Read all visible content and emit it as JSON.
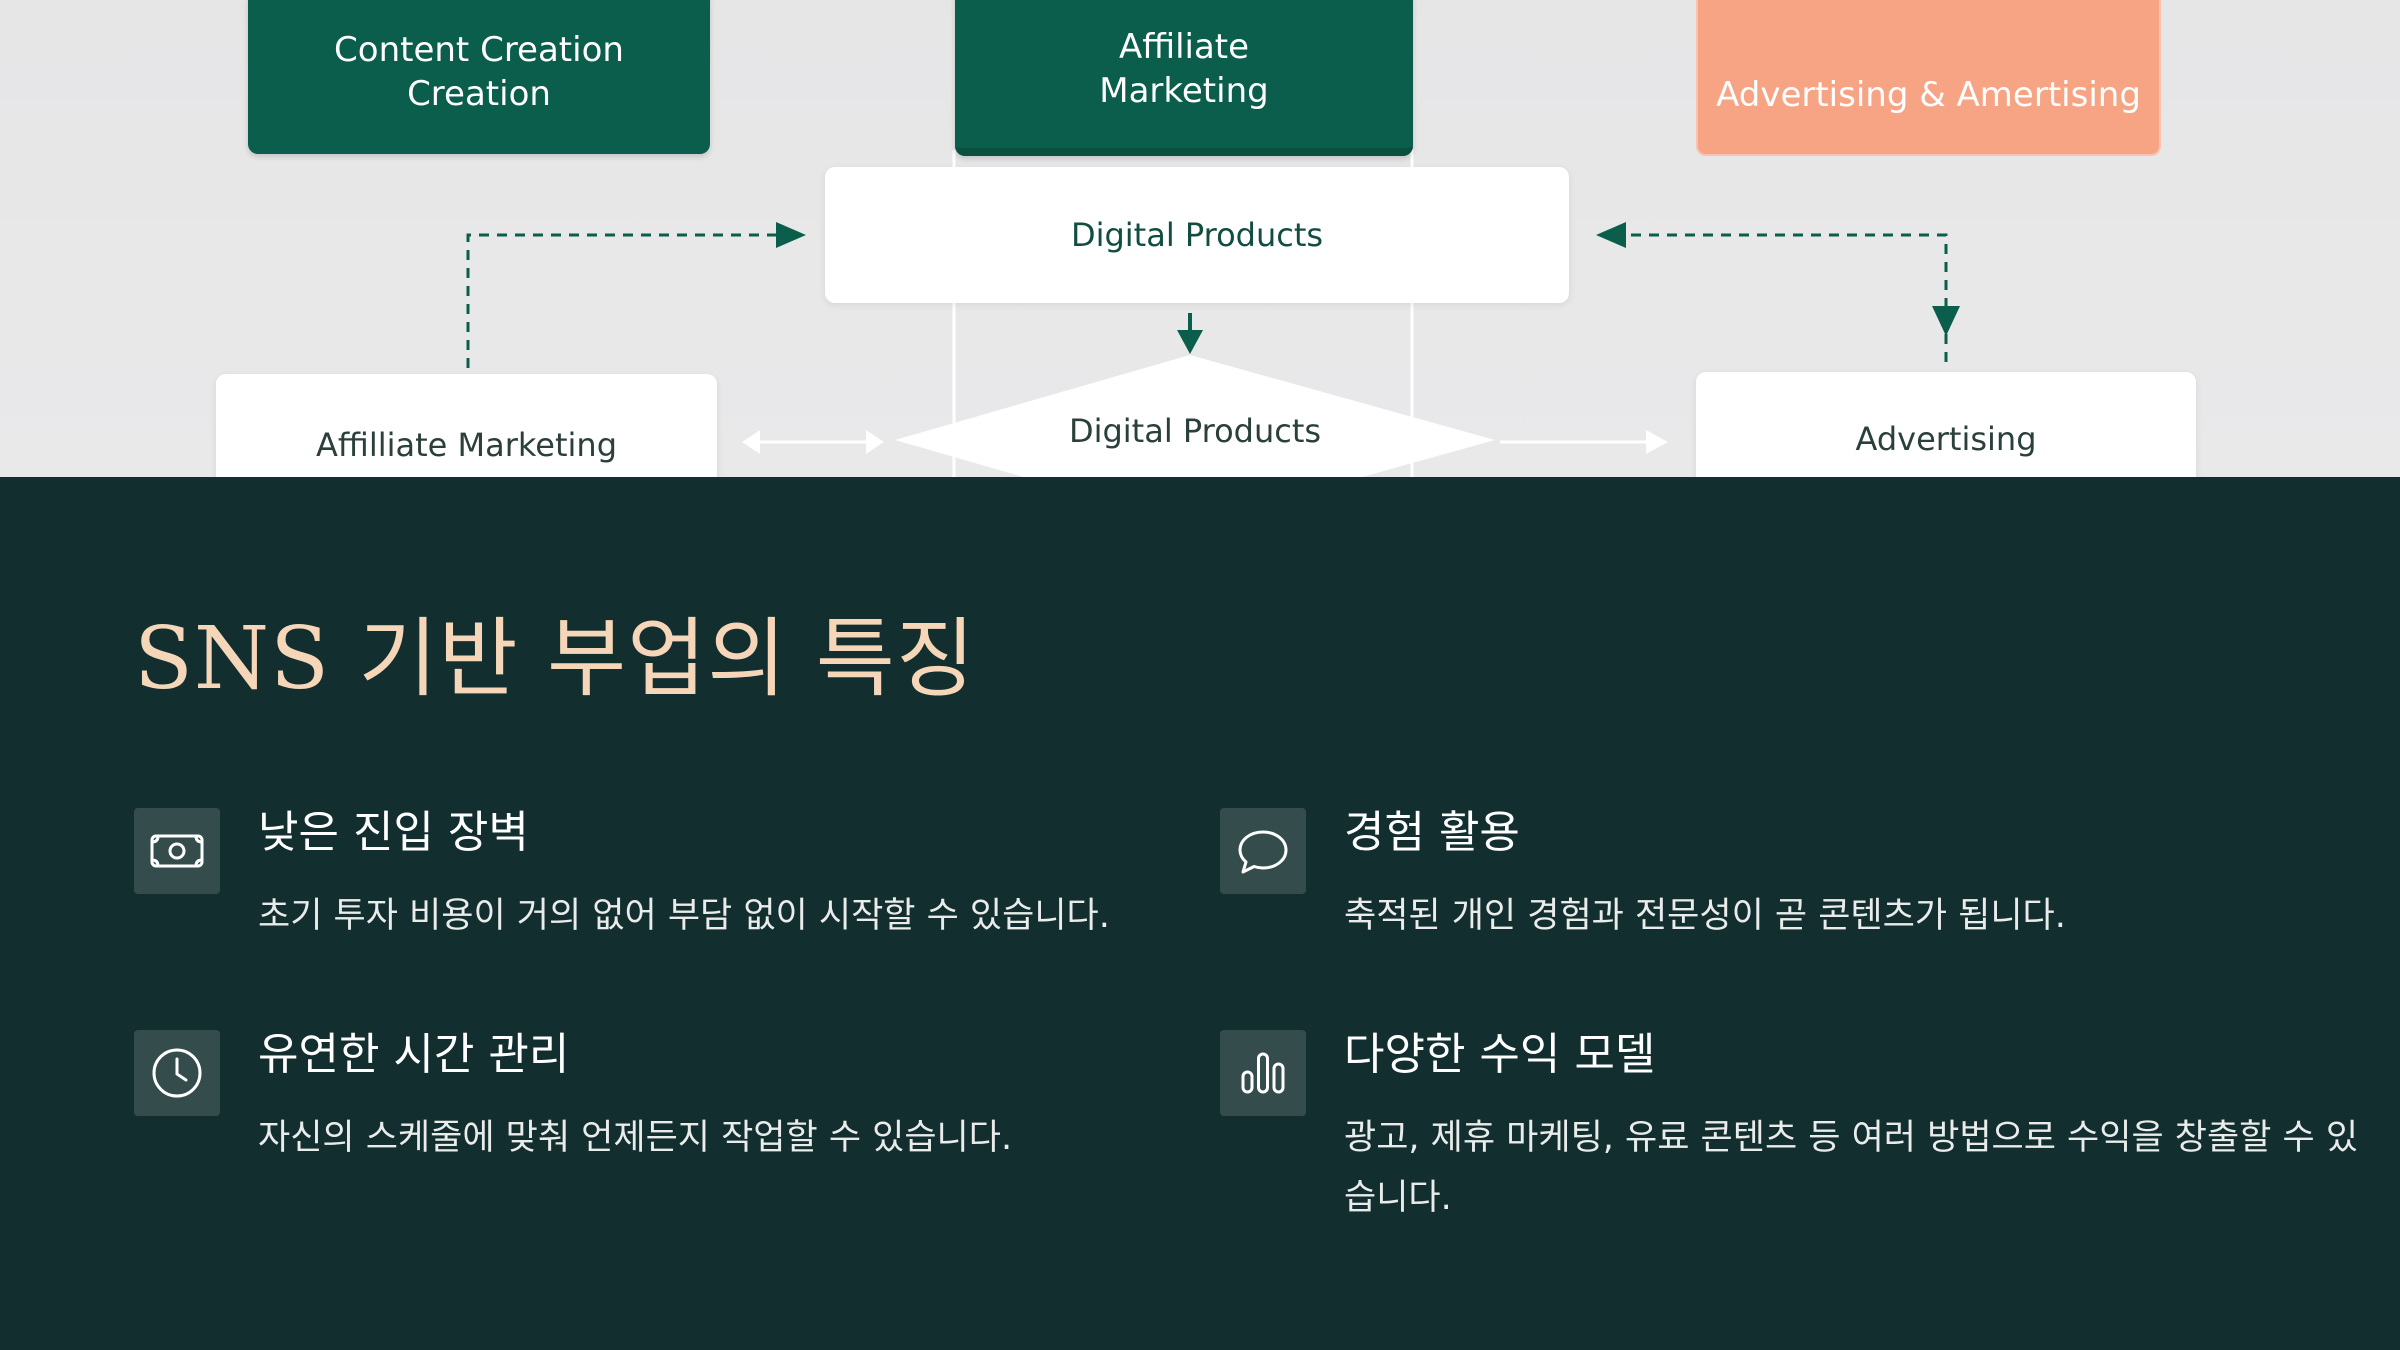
{
  "diagram": {
    "top_boxes": [
      {
        "label": "Content Creation\nCreation"
      },
      {
        "label": "Affiliate\nMarketing"
      },
      {
        "label": "Advertising & Amertising"
      }
    ],
    "center_box": {
      "label": "Digital Products"
    },
    "bottom_left": {
      "label": "Affilliate Marketing"
    },
    "diamond": {
      "label": "Digital Products"
    },
    "bottom_right": {
      "label": "Advertising"
    },
    "colors": {
      "green": "#0b5e4c",
      "salmon": "#f7a485",
      "white": "#ffffff",
      "bg": "#e6e6e7"
    }
  },
  "section": {
    "title": "SNS 기반 부업의 특징",
    "background": "#132e2f",
    "title_color": "#f6d6b8"
  },
  "features": [
    {
      "icon": "money-icon",
      "title": "낮은 진입 장벽",
      "desc": "초기 투자 비용이 거의 없어 부담 없이 시작할 수 있습니다."
    },
    {
      "icon": "speech-bubble-icon",
      "title": "경험 활용",
      "desc": "축적된 개인 경험과 전문성이 곧 콘텐츠가 됩니다."
    },
    {
      "icon": "clock-icon",
      "title": "유연한 시간 관리",
      "desc": "자신의 스케줄에 맞춰 언제든지 작업할 수 있습니다."
    },
    {
      "icon": "bar-chart-icon",
      "title": "다양한 수익 모델",
      "desc": "광고, 제휴 마케팅, 유료 콘텐츠 등 여러 방법으로 수익을 창출할 수 있습니다."
    }
  ]
}
